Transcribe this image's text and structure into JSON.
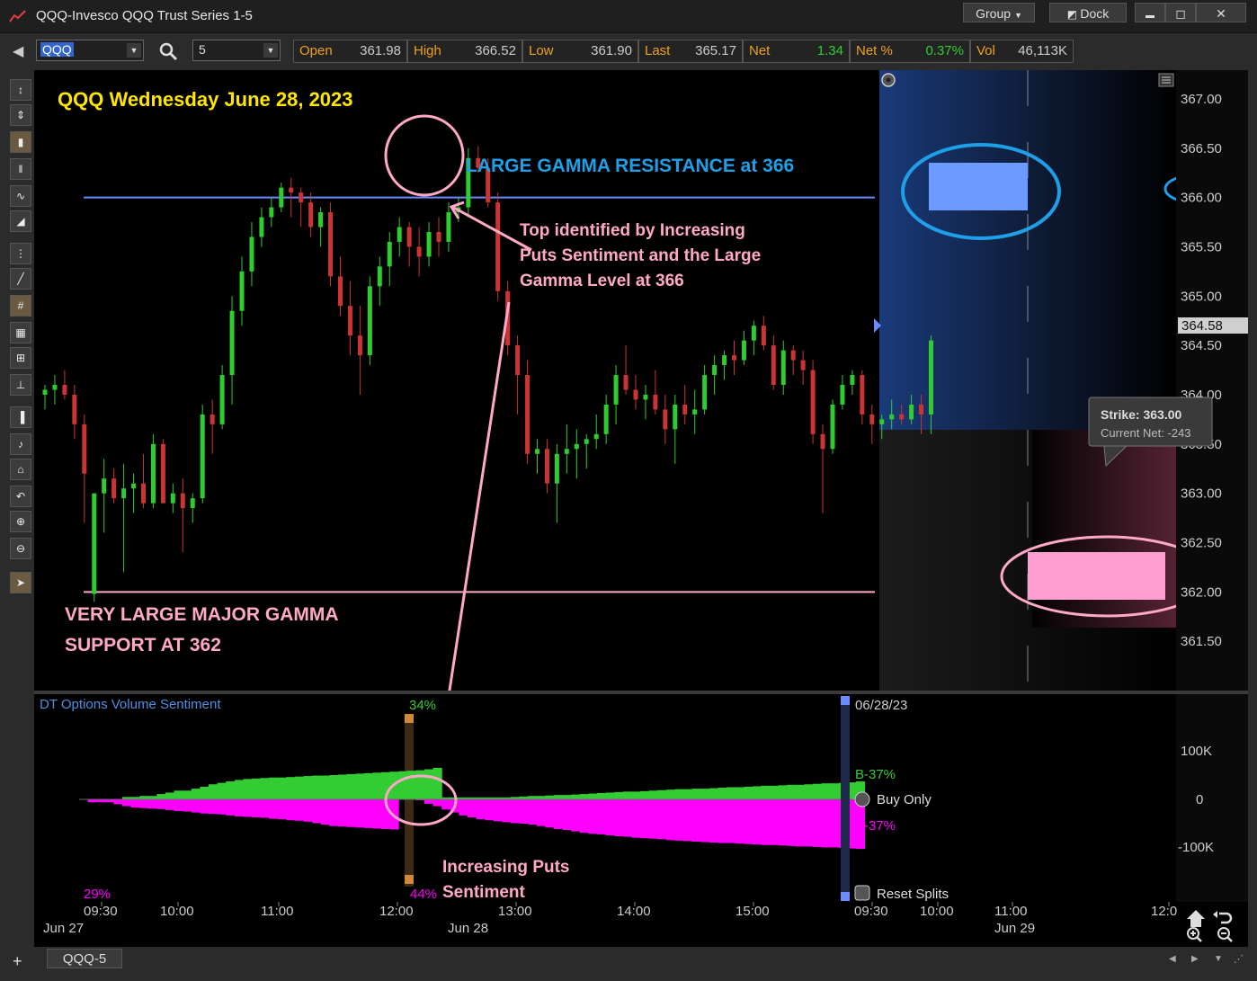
{
  "window": {
    "title": "QQQ-Invesco QQQ Trust Series 1-5",
    "group_label": "Group",
    "dock_label": "Dock",
    "minimize_glyph": "▬",
    "restore_glyph": "◻",
    "close_glyph": "✕"
  },
  "toolbar": {
    "symbol": "QQQ",
    "interval": "5",
    "quote": [
      {
        "label": "Open",
        "value": "361.98"
      },
      {
        "label": "High",
        "value": "366.52"
      },
      {
        "label": "Low",
        "value": "361.90"
      },
      {
        "label": "Last",
        "value": "365.17"
      },
      {
        "label": "Net",
        "value": "1.34"
      },
      {
        "label": "Net %",
        "value": "0.37%"
      },
      {
        "label": "Vol",
        "value": "46,113K"
      }
    ]
  },
  "annotations": {
    "chart_title": "QQQ Wednesday June 28, 2023",
    "resistance_label": "LARGE GAMMA RESISTANCE at 366",
    "top_note_line1": "Top identified by Increasing",
    "top_note_line2": "Puts Sentiment and the Large",
    "top_note_line3": "Gamma Level at 366",
    "support_line1": "VERY LARGE MAJOR GAMMA",
    "support_line2": "SUPPORT AT 362",
    "puts_line1": "Increasing Puts",
    "puts_line2": "Sentiment"
  },
  "tooltip": {
    "strike": "Strike: 363.00",
    "current_net": "Current Net: -243"
  },
  "price_axis": {
    "current_price": "364.58",
    "ticks": [
      "367.00",
      "366.50",
      "366.00",
      "365.50",
      "365.00",
      "364.50",
      "364.00",
      "363.50",
      "363.00",
      "362.50",
      "362.00",
      "361.50"
    ]
  },
  "sentiment_panel": {
    "title": "DT Options Volume Sentiment",
    "date": "06/28/23",
    "top_pct": "34%",
    "bottom_pct": "44%",
    "left_pct": "29%",
    "buy_label": "B-37%",
    "sell_label": "B-37%",
    "buy_only": "Buy Only",
    "reset_splits": "Reset Splits",
    "axis": [
      "100K",
      "0",
      "-100K"
    ]
  },
  "time_axis": {
    "labels": [
      "09:30",
      "10:00",
      "11:00",
      "12:00",
      "13:00",
      "14:00",
      "15:00",
      "09:30",
      "10:00",
      "11:00",
      "12:0"
    ],
    "dates": [
      "Jun 27",
      "Jun 28",
      "Jun 29"
    ]
  },
  "bottom_tab": "QQQ-5",
  "colors": {
    "up": "#2ecc2e",
    "down": "#cc3333",
    "resistance": "#6b8cff",
    "support": "#ffa8c8",
    "title_yellow": "#ffe600",
    "blue_text": "#1ea0e8",
    "pink_text": "#ffa8c8",
    "magenta": "#ff00ff",
    "green_fill": "#33cc33"
  },
  "chart_data": {
    "type": "candlestick",
    "ylim": [
      361.0,
      367.2
    ],
    "resistance_level": 366.0,
    "support_level": 362.0,
    "ohlc": [
      [
        364.0,
        364.1,
        363.85,
        364.05
      ],
      [
        364.05,
        364.2,
        363.9,
        364.1
      ],
      [
        364.1,
        364.25,
        363.95,
        364.0
      ],
      [
        364.0,
        364.1,
        363.55,
        363.7
      ],
      [
        363.7,
        363.8,
        362.7,
        363.2
      ],
      [
        361.98,
        363.0,
        361.9,
        363.0
      ],
      [
        363.0,
        363.35,
        362.6,
        363.15
      ],
      [
        363.15,
        363.25,
        362.9,
        362.95
      ],
      [
        362.95,
        363.3,
        362.2,
        363.05
      ],
      [
        363.05,
        363.2,
        362.8,
        363.1
      ],
      [
        363.1,
        363.4,
        362.85,
        362.9
      ],
      [
        362.9,
        363.6,
        362.85,
        363.5
      ],
      [
        363.5,
        363.55,
        362.9,
        362.9
      ],
      [
        362.9,
        363.1,
        362.8,
        363.0
      ],
      [
        363.0,
        363.15,
        362.4,
        362.85
      ],
      [
        362.85,
        363.0,
        362.7,
        362.95
      ],
      [
        362.95,
        363.9,
        362.9,
        363.8
      ],
      [
        363.8,
        363.95,
        363.4,
        363.7
      ],
      [
        363.7,
        364.3,
        363.65,
        364.2
      ],
      [
        364.2,
        365.0,
        363.9,
        364.85
      ],
      [
        364.85,
        365.4,
        364.7,
        365.25
      ],
      [
        365.25,
        365.75,
        365.1,
        365.6
      ],
      [
        365.6,
        365.9,
        365.5,
        365.8
      ],
      [
        365.8,
        366.0,
        365.7,
        365.9
      ],
      [
        365.9,
        366.15,
        365.85,
        366.1
      ],
      [
        366.1,
        366.2,
        365.8,
        366.05
      ],
      [
        366.05,
        366.1,
        365.7,
        365.95
      ],
      [
        365.95,
        366.05,
        365.6,
        365.7
      ],
      [
        365.7,
        365.9,
        365.5,
        365.85
      ],
      [
        365.85,
        365.95,
        365.1,
        365.2
      ],
      [
        365.2,
        365.4,
        364.8,
        364.9
      ],
      [
        364.9,
        365.15,
        364.4,
        364.6
      ],
      [
        364.6,
        364.9,
        364.0,
        364.4
      ],
      [
        364.4,
        365.2,
        364.3,
        365.1
      ],
      [
        365.1,
        365.4,
        364.9,
        365.3
      ],
      [
        365.3,
        365.65,
        365.1,
        365.55
      ],
      [
        365.55,
        365.8,
        365.4,
        365.7
      ],
      [
        365.7,
        365.75,
        365.3,
        365.5
      ],
      [
        365.5,
        365.7,
        365.2,
        365.4
      ],
      [
        365.4,
        365.75,
        365.3,
        365.65
      ],
      [
        365.65,
        365.8,
        365.4,
        365.55
      ],
      [
        365.55,
        365.95,
        365.45,
        365.85
      ],
      [
        365.85,
        366.0,
        365.75,
        365.9
      ],
      [
        365.9,
        366.5,
        365.8,
        366.4
      ],
      [
        366.4,
        366.52,
        366.25,
        366.3
      ],
      [
        366.3,
        366.4,
        365.9,
        365.95
      ],
      [
        365.95,
        366.05,
        364.95,
        365.05
      ],
      [
        365.05,
        365.15,
        364.4,
        364.5
      ],
      [
        364.5,
        364.6,
        363.8,
        364.2
      ],
      [
        364.2,
        364.35,
        363.3,
        363.4
      ],
      [
        363.4,
        363.55,
        363.2,
        363.45
      ],
      [
        363.45,
        363.55,
        363.0,
        363.1
      ],
      [
        363.1,
        363.5,
        362.7,
        363.4
      ],
      [
        363.4,
        363.7,
        363.2,
        363.45
      ],
      [
        363.45,
        363.65,
        363.15,
        363.5
      ],
      [
        363.5,
        363.6,
        363.25,
        363.55
      ],
      [
        363.55,
        363.8,
        363.45,
        363.6
      ],
      [
        363.6,
        364.0,
        363.5,
        363.9
      ],
      [
        363.9,
        364.3,
        363.7,
        364.2
      ],
      [
        364.2,
        364.5,
        364.0,
        364.05
      ],
      [
        364.05,
        364.2,
        363.85,
        363.95
      ],
      [
        363.95,
        364.1,
        363.75,
        364.0
      ],
      [
        364.0,
        364.25,
        363.8,
        363.85
      ],
      [
        363.85,
        364.0,
        363.5,
        363.65
      ],
      [
        363.65,
        364.0,
        363.3,
        363.9
      ],
      [
        363.9,
        364.1,
        363.7,
        363.8
      ],
      [
        363.8,
        364.05,
        363.6,
        363.85
      ],
      [
        363.85,
        364.3,
        363.8,
        364.2
      ],
      [
        364.2,
        364.4,
        364.0,
        364.3
      ],
      [
        364.3,
        364.45,
        364.15,
        364.4
      ],
      [
        364.4,
        364.55,
        364.2,
        364.35
      ],
      [
        364.35,
        364.65,
        364.3,
        364.55
      ],
      [
        364.55,
        364.75,
        364.4,
        364.7
      ],
      [
        364.7,
        364.8,
        364.45,
        364.5
      ],
      [
        364.5,
        364.6,
        364.05,
        364.1
      ],
      [
        364.1,
        364.55,
        364.0,
        364.45
      ],
      [
        364.45,
        364.5,
        364.2,
        364.35
      ],
      [
        364.35,
        364.45,
        364.1,
        364.25
      ],
      [
        364.25,
        364.35,
        363.5,
        363.6
      ],
      [
        363.6,
        363.7,
        362.8,
        363.45
      ],
      [
        363.45,
        363.95,
        363.4,
        363.9
      ],
      [
        363.9,
        364.2,
        363.85,
        364.1
      ],
      [
        364.1,
        364.25,
        364.0,
        364.2
      ],
      [
        364.2,
        364.25,
        363.7,
        363.8
      ],
      [
        363.8,
        363.9,
        363.5,
        363.7
      ],
      [
        363.7,
        363.8,
        363.55,
        363.75
      ],
      [
        363.75,
        363.95,
        363.65,
        363.8
      ],
      [
        363.8,
        363.9,
        363.7,
        363.75
      ],
      [
        363.75,
        364.0,
        363.7,
        363.9
      ],
      [
        363.9,
        364.0,
        363.6,
        363.8
      ],
      [
        363.8,
        364.6,
        363.6,
        364.55
      ]
    ],
    "sentiment_buy": [
      0,
      0,
      0,
      0,
      0,
      5,
      5,
      7,
      7,
      11,
      14,
      18,
      18,
      22,
      26,
      31,
      34,
      37,
      40,
      42,
      43,
      44,
      45,
      45,
      46,
      47,
      48,
      49,
      49,
      50,
      51,
      52,
      53,
      54,
      55,
      56,
      57,
      58,
      59,
      60,
      62,
      65,
      4,
      4,
      4,
      4,
      4,
      4,
      4,
      4,
      5,
      6,
      7,
      7,
      8,
      9,
      9,
      10,
      11,
      12,
      13,
      14,
      15,
      16,
      16,
      17,
      18,
      19,
      20,
      21,
      21,
      22,
      22,
      23,
      24,
      25,
      25,
      26,
      27,
      28,
      28,
      29,
      30,
      30,
      31,
      32,
      33,
      33,
      34,
      35,
      37
    ],
    "sentiment_sell": [
      0,
      -6,
      -6,
      -6,
      -10,
      -14,
      -17,
      -18,
      -19,
      -20,
      -22,
      -24,
      -25,
      -27,
      -29,
      -30,
      -31,
      -33,
      -35,
      -36,
      -37,
      -38,
      -40,
      -41,
      -43,
      -44,
      -46,
      -49,
      -52,
      -55,
      -56,
      -57,
      -58,
      -59,
      -60,
      -61,
      -62,
      0,
      0,
      -2,
      -9,
      -14,
      -21,
      -27,
      -33,
      -37,
      -41,
      -43,
      -45,
      -47,
      -49,
      -50,
      -52,
      -55,
      -58,
      -61,
      -63,
      -66,
      -69,
      -71,
      -72,
      -74,
      -76,
      -77,
      -79,
      -80,
      -81,
      -82,
      -84,
      -85,
      -86,
      -87,
      -88,
      -89,
      -90,
      -90,
      -91,
      -92,
      -93,
      -94,
      -94,
      -95,
      -96,
      -97,
      -97,
      -98,
      -99,
      -99,
      -100,
      -101,
      -102
    ]
  }
}
